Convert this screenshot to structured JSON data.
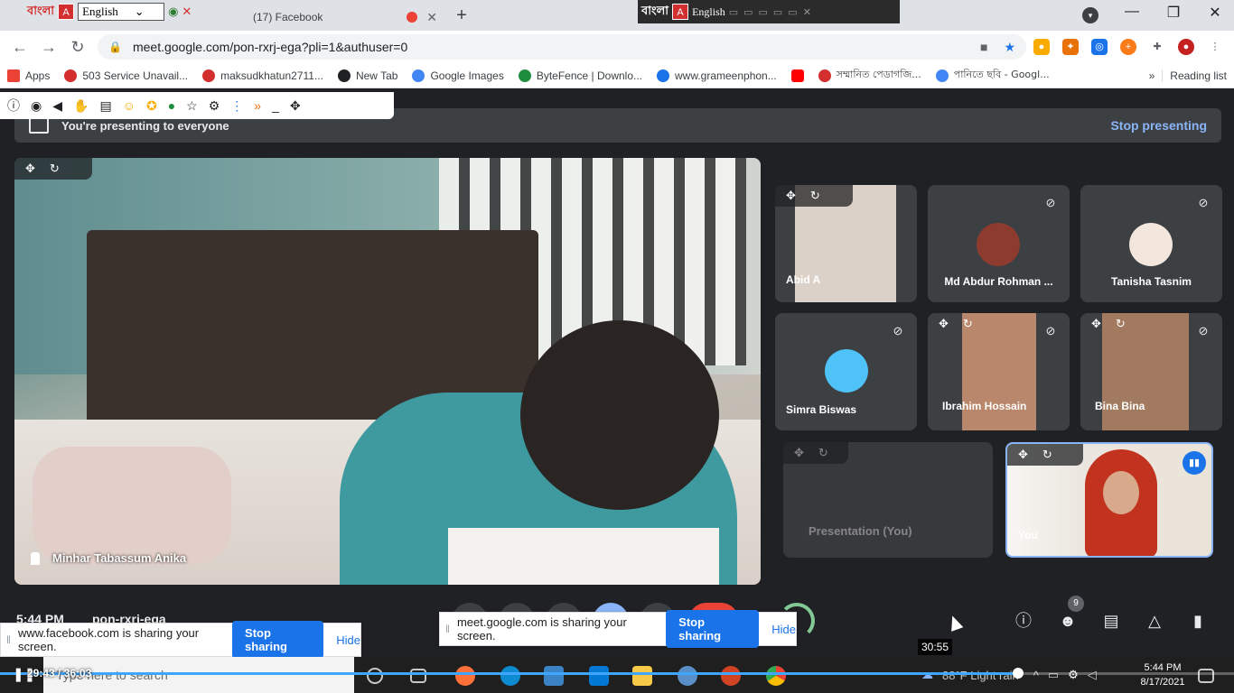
{
  "browser": {
    "language_widget": {
      "logo_text": "বাংলা",
      "language": "English"
    },
    "tabs": [
      {
        "title": "(17) Facebook"
      }
    ],
    "new_tab_symbol": "+",
    "url": "meet.google.com/pon-rxrj-ega?pli=1&authuser=0",
    "bookmarks": [
      {
        "label": "Apps"
      },
      {
        "label": "503 Service Unavail..."
      },
      {
        "label": "maksudkhatun2711..."
      },
      {
        "label": "New Tab"
      },
      {
        "label": "Google Images"
      },
      {
        "label": "ByteFence | Downlo..."
      },
      {
        "label": "www.grameenphon..."
      },
      {
        "label": "সম্মানিত পেডাগজি..."
      },
      {
        "label": "পানিতে ছবি - Googl..."
      }
    ],
    "bookmarks_more": "»",
    "reading_list": "Reading list",
    "overlay_language": "English"
  },
  "meet": {
    "presenting_text": "You're presenting to everyone",
    "stop_presenting": "Stop presenting",
    "main_participant": "Minhar Tabassum Anika",
    "participants": [
      {
        "name": "Abid A"
      },
      {
        "name": "Md Abdur Rohman ..."
      },
      {
        "name": "Tanisha Tasnim"
      },
      {
        "name": "Simra Biswas"
      },
      {
        "name": "Ibrahim Hossain"
      },
      {
        "name": "Bina Bina"
      }
    ],
    "self_presentation": "Presentation (You)",
    "self": "You",
    "time": "5:44 PM",
    "meeting_code": "pon-rxrj-ega",
    "people_count": "9"
  },
  "share_bars": {
    "facebook": {
      "text": "www.facebook.com is sharing your screen.",
      "stop": "Stop sharing",
      "hide": "Hide"
    },
    "meet": {
      "text": "meet.google.com is sharing your screen.",
      "stop": "Stop sharing",
      "hide": "Hide"
    }
  },
  "video_player": {
    "time_display": "29:43 / 36:03",
    "hover_time": "30:55",
    "progress": 0.825,
    "hover_position": 0.857
  },
  "taskbar": {
    "search_placeholder": "Type here to search",
    "weather": "88°F  Light rain",
    "clock_time": "5:44 PM",
    "clock_date": "8/17/2021"
  },
  "colors": {
    "meet_bg": "#202124",
    "accent_blue": "#1a73e8",
    "link_blue": "#8ab4f8"
  }
}
